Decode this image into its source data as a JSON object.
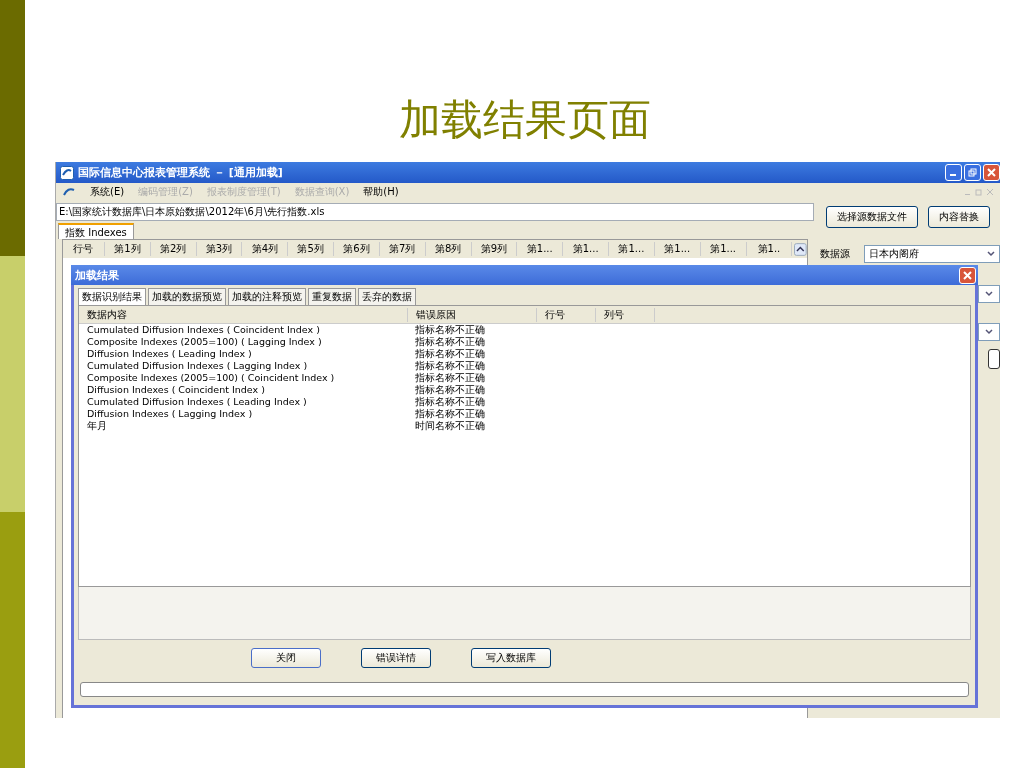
{
  "slide_title": "加载结果页面",
  "window": {
    "title": "国际信息中心报表管理系统 － [通用加载]"
  },
  "menu": [
    {
      "label": "系统(E)",
      "disabled": false
    },
    {
      "label": "编码管理(Z)",
      "disabled": true
    },
    {
      "label": "报表制度管理(T)",
      "disabled": true
    },
    {
      "label": "数据查询(X)",
      "disabled": true
    },
    {
      "label": "帮助(H)",
      "disabled": false
    }
  ],
  "path_field": {
    "value": "E:\\国家统计数据库\\日本原始数据\\2012年\\6月\\先行指数.xls"
  },
  "buttons_top": [
    "选择源数据文件",
    "内容替换"
  ],
  "sheet_tabs": [
    {
      "label": "指数 Indexes",
      "selected": true
    }
  ],
  "grid": {
    "columns": [
      "行号",
      "第1列",
      "第2列",
      "第3列",
      "第4列",
      "第5列",
      "第6列",
      "第7列",
      "第8列",
      "第9列",
      "第1...",
      "第1...",
      "第1...",
      "第1...",
      "第1...",
      "第1.."
    ]
  },
  "source": {
    "label": "数据源",
    "value": "日本内阁府"
  },
  "dialog": {
    "title": "加载结果",
    "tabs": [
      {
        "label": "数据识别结果",
        "selected": true
      },
      {
        "label": "加载的数据预览",
        "selected": false
      },
      {
        "label": "加载的注释预览",
        "selected": false
      },
      {
        "label": "重复数据",
        "selected": false
      },
      {
        "label": "丢弃的数据",
        "selected": false
      }
    ],
    "columns": [
      "数据内容",
      "错误原因",
      "行号",
      "列号"
    ],
    "rows": [
      {
        "content": "Cumulated Diffusion Indexes ( Coincident Index )",
        "reason": "指标名称不正确"
      },
      {
        "content": "Composite Indexes  (2005=100) ( Lagging Index )",
        "reason": "指标名称不正确"
      },
      {
        "content": "Diffusion Indexes ( Leading Index )",
        "reason": "指标名称不正确"
      },
      {
        "content": "Cumulated Diffusion Indexes ( Lagging Index )",
        "reason": "指标名称不正确"
      },
      {
        "content": "Composite Indexes  (2005=100) ( Coincident Index )",
        "reason": "指标名称不正确"
      },
      {
        "content": "Diffusion Indexes ( Coincident Index )",
        "reason": "指标名称不正确"
      },
      {
        "content": "Cumulated Diffusion Indexes ( Leading Index )",
        "reason": "指标名称不正确"
      },
      {
        "content": "Diffusion Indexes ( Lagging Index )",
        "reason": "指标名称不正确"
      },
      {
        "content": "年月",
        "reason": "时间名称不正确"
      }
    ],
    "buttons": [
      "关闭",
      "错误详情",
      "写入数据库"
    ],
    "progress": {
      "level": 0
    }
  }
}
